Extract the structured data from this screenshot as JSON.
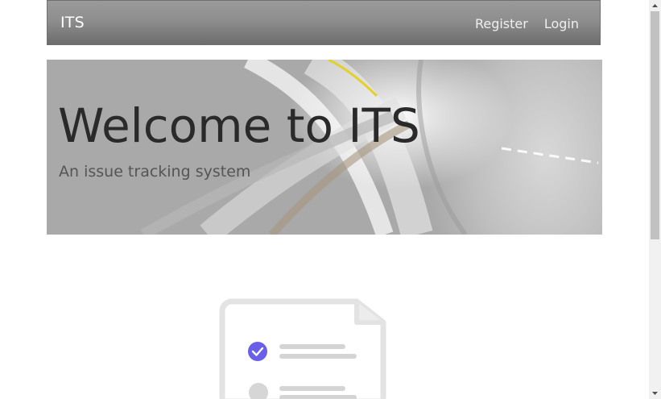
{
  "navbar": {
    "brand": "ITS",
    "links": [
      {
        "label": "Register"
      },
      {
        "label": "Login"
      }
    ]
  },
  "hero": {
    "title": "Welcome to ITS",
    "subtitle": "An issue tracking system"
  },
  "illustration": {
    "icon": "checklist-document-icon",
    "accent_color": "#6a5fe8"
  }
}
